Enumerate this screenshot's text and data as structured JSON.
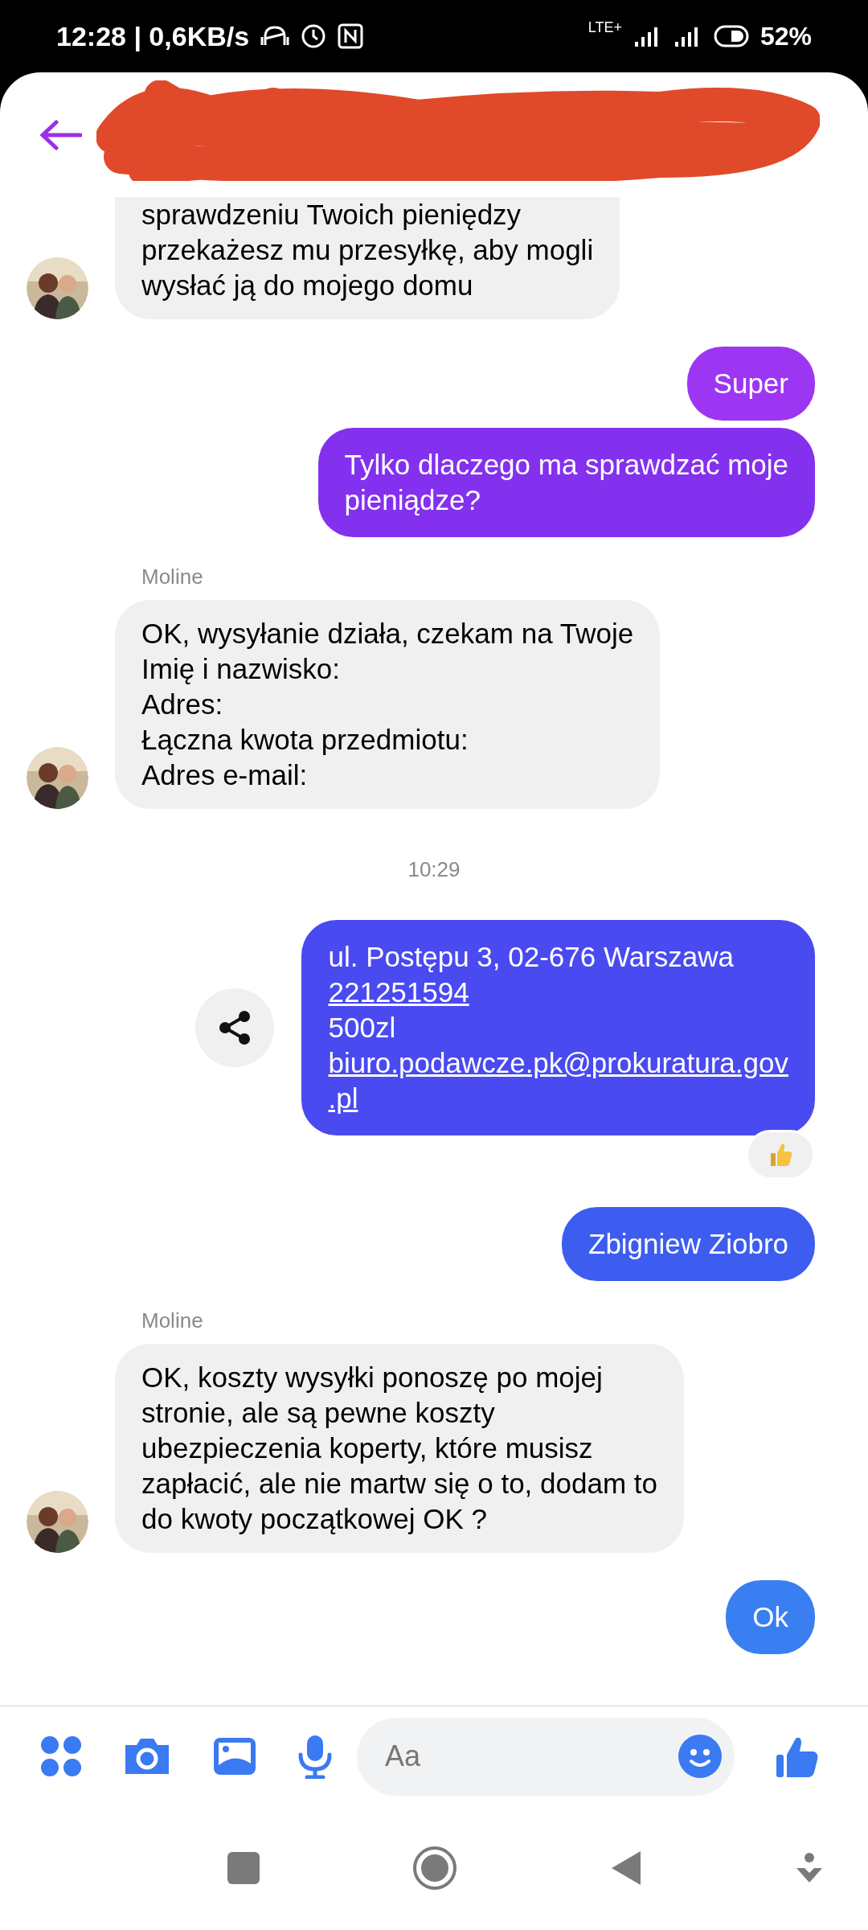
{
  "status_bar": {
    "time": "12:28 | 0,6KB/s",
    "network": "LTE+",
    "battery": "52%"
  },
  "header": {
    "redacted": true
  },
  "messages": [
    {
      "kind": "received",
      "avatar": true,
      "cut_top": true,
      "lines": [
        {
          "text": "sprawdzeniu Twoich pieniędzy",
          "link": false
        },
        {
          "text": "przekażesz mu przesyłkę, aby mogli",
          "link": false
        },
        {
          "text": "wysłać ją do mojego domu",
          "link": false
        }
      ]
    },
    {
      "kind": "sent",
      "color": "#9d36f3",
      "lines": [
        {
          "text": "Super",
          "link": false
        }
      ]
    },
    {
      "kind": "sent",
      "color": "#8430ef",
      "lines": [
        {
          "text": "Tylko dlaczego ma sprawdzać moje",
          "link": false
        },
        {
          "text": "pieniądze?",
          "link": false
        }
      ]
    },
    {
      "kind": "sender_name",
      "text": "Moline"
    },
    {
      "kind": "received",
      "avatar": true,
      "cut_top": false,
      "lines": [
        {
          "text": "OK, wysyłanie działa, czekam na Twoje",
          "link": false
        },
        {
          "text": "Imię i nazwisko:",
          "link": false
        },
        {
          "text": "Adres:",
          "link": false
        },
        {
          "text": "Łączna kwota przedmiotu:",
          "link": false
        },
        {
          "text": "Adres e-mail:",
          "link": false
        }
      ]
    },
    {
      "kind": "timestamp",
      "text": "10:29"
    },
    {
      "kind": "sent",
      "color": "#4a4af1",
      "share": true,
      "reacted": true,
      "lines": [
        {
          "text": "ul. Postępu 3, 02-676 Warszawa",
          "link": false
        },
        {
          "text": "221251594",
          "link": true
        },
        {
          "text": "500zl",
          "link": false
        },
        {
          "text": "biuro.podawcze.pk@prokuratura.gov",
          "link": true
        },
        {
          "text": ".pl",
          "link": true
        }
      ]
    },
    {
      "kind": "sent",
      "color": "#3d5df0",
      "lines": [
        {
          "text": "Zbigniew Ziobro",
          "link": false
        }
      ]
    },
    {
      "kind": "sender_name",
      "text": "Moline"
    },
    {
      "kind": "received",
      "avatar": true,
      "cut_top": false,
      "lines": [
        {
          "text": "OK, koszty wysyłki ponoszę po mojej",
          "link": false
        },
        {
          "text": "stronie, ale są pewne koszty",
          "link": false
        },
        {
          "text": "ubezpieczenia koperty, które musisz",
          "link": false
        },
        {
          "text": "zapłacić, ale nie martw się o to, dodam to",
          "link": false
        },
        {
          "text": "do kwoty początkowej OK ?",
          "link": false
        }
      ]
    },
    {
      "kind": "sent",
      "color": "#3a7ff2",
      "lines": [
        {
          "text": "Ok",
          "link": false
        }
      ]
    }
  ],
  "composer": {
    "placeholder": "Aa"
  }
}
